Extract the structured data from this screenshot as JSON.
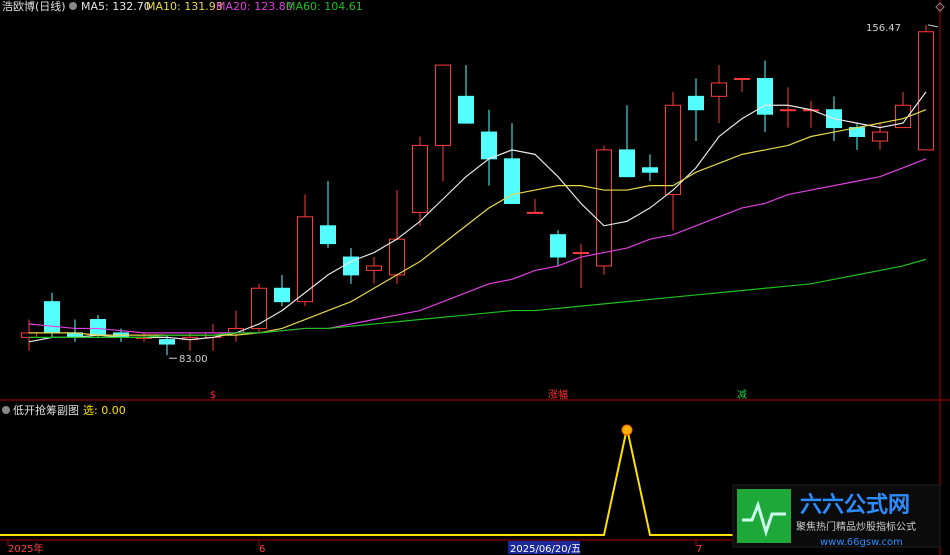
{
  "header": {
    "stock_name": "浩欧博(日线)",
    "ma5": "MA5: 132.70",
    "ma10": "MA10: 131.93",
    "ma20": "MA20: 123.80",
    "ma60": "MA60: 104.61"
  },
  "price_labels": {
    "high": "156.47",
    "low": "83.00"
  },
  "markers": [
    {
      "text": "$",
      "color": "#ff3030",
      "index": 8
    },
    {
      "text": "涨幅",
      "color": "#ff3030",
      "index": 23
    },
    {
      "text": "减",
      "color": "#22cc44",
      "index": 31
    }
  ],
  "sub_indicator": {
    "name": "低开抢筹副图",
    "label": "选: 0.00"
  },
  "x_axis": {
    "labels": [
      {
        "text": "2025年",
        "index": 0
      },
      {
        "text": "6",
        "index": 10
      },
      {
        "text": "2025/06/20/五",
        "index": 23,
        "highlight": true
      },
      {
        "text": "7",
        "index": 29
      }
    ]
  },
  "watermark": {
    "title": "六六公式网",
    "subtitle": "聚焦热门精品炒股指标公式",
    "url": "www.66gsw.com"
  },
  "colors": {
    "up": "#ff3a3a",
    "down": "#54ffff",
    "ma5": "#e6e6e6",
    "ma10": "#e6d84a",
    "ma20": "#e040e0",
    "ma60": "#1fbf1f",
    "signal": "#ffe000",
    "axis": "#b00000"
  },
  "chart_data": {
    "type": "candlestick",
    "ylim": [
      78,
      160
    ],
    "candles": [
      {
        "o": 88,
        "h": 92,
        "l": 85,
        "c": 89
      },
      {
        "o": 96,
        "h": 98,
        "l": 88,
        "c": 89
      },
      {
        "o": 89,
        "h": 92,
        "l": 87,
        "c": 88
      },
      {
        "o": 92,
        "h": 93,
        "l": 88,
        "c": 88.5
      },
      {
        "o": 89,
        "h": 90,
        "l": 87,
        "c": 88
      },
      {
        "o": 88,
        "h": 89,
        "l": 87,
        "c": 88
      },
      {
        "o": 87.5,
        "h": 88.5,
        "l": 84,
        "c": 86.5
      },
      {
        "o": 87.5,
        "h": 89,
        "l": 85,
        "c": 88
      },
      {
        "o": 88,
        "h": 91,
        "l": 85,
        "c": 89
      },
      {
        "o": 89,
        "h": 94,
        "l": 87,
        "c": 90
      },
      {
        "o": 90,
        "h": 100,
        "l": 89,
        "c": 99
      },
      {
        "o": 99,
        "h": 102,
        "l": 95,
        "c": 96
      },
      {
        "o": 96,
        "h": 120,
        "l": 95,
        "c": 115
      },
      {
        "o": 113,
        "h": 123,
        "l": 108,
        "c": 109
      },
      {
        "o": 106,
        "h": 108,
        "l": 100,
        "c": 102
      },
      {
        "o": 103,
        "h": 106,
        "l": 100,
        "c": 104
      },
      {
        "o": 102,
        "h": 121,
        "l": 100,
        "c": 110
      },
      {
        "o": 116,
        "h": 133,
        "l": 113,
        "c": 131
      },
      {
        "o": 131,
        "h": 145,
        "l": 123,
        "c": 149
      },
      {
        "o": 142,
        "h": 149,
        "l": 137,
        "c": 136
      },
      {
        "o": 134,
        "h": 139,
        "l": 122,
        "c": 128
      },
      {
        "o": 128,
        "h": 136,
        "l": 118,
        "c": 118
      },
      {
        "o": 116,
        "h": 119,
        "l": 116,
        "c": 116
      },
      {
        "o": 111,
        "h": 112,
        "l": 104,
        "c": 106
      },
      {
        "o": 107,
        "h": 109,
        "l": 99,
        "c": 107
      },
      {
        "o": 104,
        "h": 131,
        "l": 102,
        "c": 130
      },
      {
        "o": 130,
        "h": 140,
        "l": 124,
        "c": 124
      },
      {
        "o": 126,
        "h": 129,
        "l": 123,
        "c": 125
      },
      {
        "o": 120,
        "h": 143,
        "l": 112,
        "c": 140
      },
      {
        "o": 142,
        "h": 146,
        "l": 132,
        "c": 139
      },
      {
        "o": 142,
        "h": 149,
        "l": 136,
        "c": 145
      },
      {
        "o": 146,
        "h": 146,
        "l": 143,
        "c": 146
      },
      {
        "o": 146,
        "h": 150,
        "l": 134,
        "c": 138
      },
      {
        "o": 139,
        "h": 144,
        "l": 135,
        "c": 139
      },
      {
        "o": 139,
        "h": 141,
        "l": 135,
        "c": 139
      },
      {
        "o": 139,
        "h": 142,
        "l": 132,
        "c": 135
      },
      {
        "o": 135,
        "h": 136,
        "l": 130,
        "c": 133
      },
      {
        "o": 132,
        "h": 136,
        "l": 130,
        "c": 134
      },
      {
        "o": 135,
        "h": 143,
        "l": 135,
        "c": 140
      },
      {
        "o": 130,
        "h": 158,
        "l": 130,
        "c": 156.47
      }
    ],
    "ma5": [
      87,
      88,
      88,
      88.5,
      88,
      88,
      88,
      87.5,
      88,
      89,
      91,
      94,
      98,
      102,
      105,
      107,
      110,
      114,
      119,
      124,
      128,
      130,
      129,
      124,
      118,
      113,
      114,
      117,
      121,
      126,
      133,
      137,
      140,
      140,
      139,
      137,
      136,
      135,
      136,
      143
    ],
    "ma10": [
      89,
      89,
      89,
      88.5,
      88.5,
      88.5,
      88.5,
      88.5,
      88.5,
      88.5,
      89,
      90,
      92,
      94,
      96,
      99,
      102,
      105,
      109,
      113,
      117,
      120,
      121,
      122,
      122,
      121,
      121,
      122,
      122,
      125,
      127,
      129,
      130,
      131,
      133,
      134,
      135,
      136,
      137,
      139
    ],
    "ma20": [
      91,
      90.5,
      90,
      90,
      89.5,
      89,
      89,
      89,
      89,
      89,
      89,
      89.5,
      90,
      90,
      91,
      92,
      93,
      94,
      96,
      98,
      100,
      101,
      103,
      104,
      106,
      107,
      108,
      110,
      111,
      113,
      115,
      117,
      118,
      120,
      121,
      122,
      123,
      124,
      126,
      128
    ],
    "ma60": [
      88,
      88,
      88,
      88,
      88,
      88,
      88.5,
      88.5,
      88.5,
      89,
      89,
      89.5,
      90,
      90,
      90.5,
      91,
      91.5,
      92,
      92.5,
      93,
      93.5,
      94,
      94,
      94.5,
      95,
      95.5,
      96,
      96.5,
      97,
      97.5,
      98,
      98.5,
      99,
      99.5,
      100,
      101,
      102,
      103,
      104,
      105.5
    ],
    "sub_series": [
      0,
      0,
      0,
      0,
      0,
      0,
      0,
      0,
      0,
      0,
      0,
      0,
      0,
      0,
      0,
      0,
      0,
      0,
      0,
      0,
      0,
      0,
      0,
      0,
      0,
      0,
      1,
      0,
      0,
      0,
      0,
      0,
      0,
      0,
      0,
      0,
      0,
      0,
      0,
      0
    ]
  }
}
